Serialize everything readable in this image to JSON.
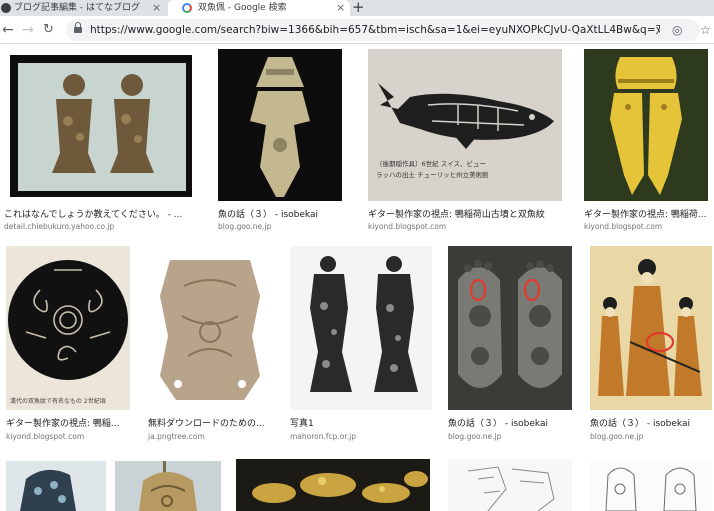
{
  "browser": {
    "tabs": [
      {
        "title": "ブログ記事編集 - はてなブログ"
      },
      {
        "title": "双魚佩 - Google 検索"
      }
    ],
    "close_glyph": "×",
    "new_tab_glyph": "+",
    "url": "https://www.google.com/search?biw=1366&bih=657&tbm=isch&sa=1&ei=eyuNXOPkCJvU-QaXtLL4Bw&q=双魚佩&oq=双..."
  },
  "results": [
    {
      "caption": "これはなんでしょうか教えてください。 - ...",
      "source": "detail.chiebukuro.yahoo.co.jp"
    },
    {
      "caption": "魚の話（３） - isobekai",
      "source": "blog.goo.ne.jp"
    },
    {
      "caption": "ギター製作家の視点: 鴨稲荷山古墳と双魚紋",
      "source": "kiyond.blogspot.com"
    },
    {
      "caption": "ギター製作家の視点: 鴨稲荷...",
      "source": "kiyond.blogspot.com"
    },
    {
      "caption": "ギター製作家の視点: 鴨稲...",
      "source": "kiyond.blogspot.com"
    },
    {
      "caption": "無料ダウンロードのための...",
      "source": "ja.pngtree.com"
    },
    {
      "caption": "写真1",
      "source": "mahoron.fcp.or.jp"
    },
    {
      "caption": "魚の話（３） - isobekai",
      "source": "blog.goo.ne.jp"
    },
    {
      "caption": "魚の話（３） - isobekai",
      "source": "blog.goo.ne.jp"
    }
  ],
  "image_texts": {
    "whale_caption": "〔後期稲作具〕6世紀 スイス、ビュー ラッハの出土 チューリッヒ州立美術館",
    "spiral_caption": "漢代の双魚紋で有名なもの 2世紀頃"
  },
  "colors": {
    "tabbar": "#dee1e6",
    "omnibox": "#f1f3f4",
    "caption": "#222222",
    "source": "#70757a"
  }
}
